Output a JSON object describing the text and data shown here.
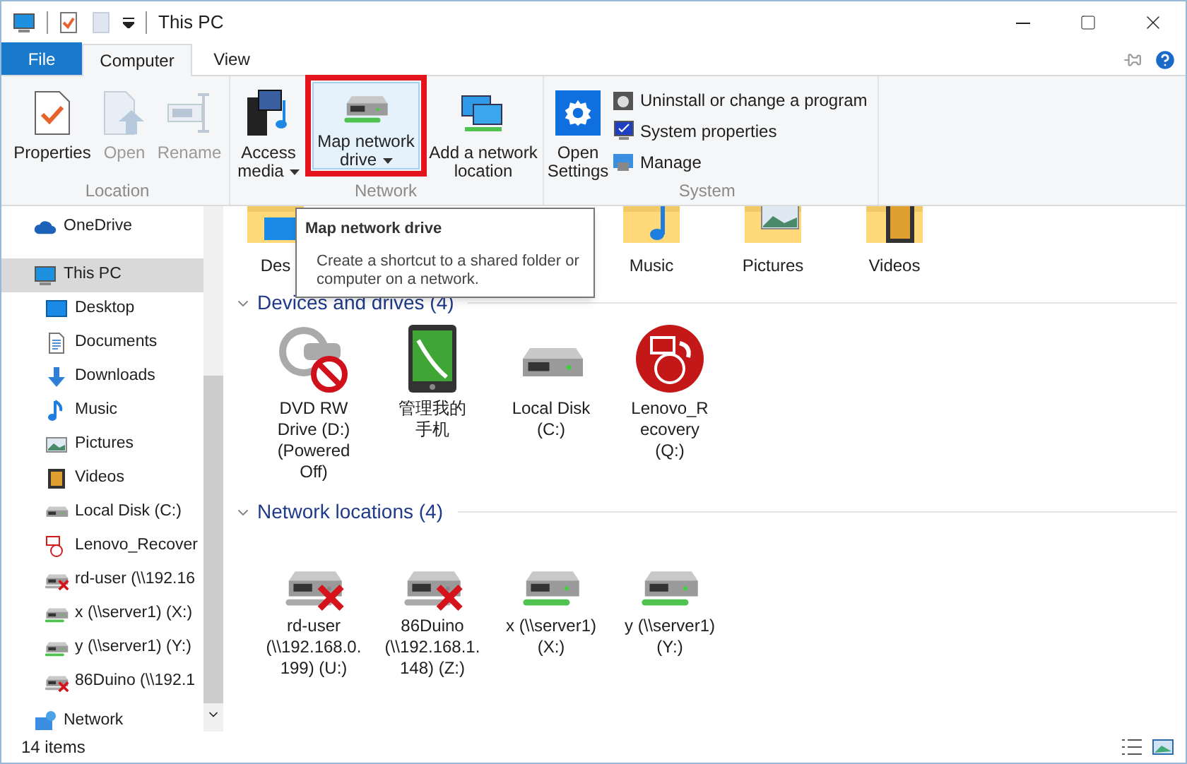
{
  "window": {
    "title": "This PC"
  },
  "ribbon_tabs": [
    {
      "label": "File",
      "kind": "file",
      "selected": false
    },
    {
      "label": "Computer",
      "kind": "tab",
      "selected": true
    },
    {
      "label": "View",
      "kind": "tab",
      "selected": false
    }
  ],
  "ribbon_groups": [
    {
      "label": "Location",
      "buttons": [
        {
          "label": "Properties",
          "kind": "properties",
          "disabled": false,
          "dropdown": false,
          "highlighted": false
        },
        {
          "label": "Open",
          "kind": "open",
          "disabled": true,
          "dropdown": false,
          "highlighted": false
        },
        {
          "label": "Rename",
          "kind": "rename",
          "disabled": true,
          "dropdown": false,
          "highlighted": false
        }
      ]
    },
    {
      "label": "Network",
      "buttons": [
        {
          "label": "Access media",
          "kind": "media",
          "disabled": false,
          "dropdown": true,
          "highlighted": false
        },
        {
          "label": "Map network drive",
          "kind": "map-drive",
          "disabled": false,
          "dropdown": true,
          "highlighted": true
        },
        {
          "label": "Add a network location",
          "kind": "add-location",
          "disabled": false,
          "dropdown": false,
          "highlighted": false
        }
      ]
    },
    {
      "label": "System",
      "buttons": [
        {
          "label": "Open Settings",
          "kind": "settings",
          "disabled": false,
          "dropdown": false,
          "highlighted": false
        }
      ],
      "small_buttons": [
        {
          "label": "Uninstall or change a program",
          "kind": "uninstall"
        },
        {
          "label": "System properties",
          "kind": "system-properties"
        },
        {
          "label": "Manage",
          "kind": "manage"
        }
      ]
    }
  ],
  "nav_pane": {
    "items": [
      {
        "label": "OneDrive",
        "kind": "onedrive",
        "selected": false
      },
      {
        "label": "This PC",
        "kind": "pc",
        "selected": true,
        "children": [
          {
            "label": "Desktop",
            "kind": "desktop",
            "selected": false
          },
          {
            "label": "Documents",
            "kind": "documents",
            "selected": false
          },
          {
            "label": "Downloads",
            "kind": "downloads",
            "selected": false
          },
          {
            "label": "Music",
            "kind": "music",
            "selected": false
          },
          {
            "label": "Pictures",
            "kind": "pictures",
            "selected": false
          },
          {
            "label": "Videos",
            "kind": "videos",
            "selected": false
          },
          {
            "label": "Local Disk (C:)",
            "kind": "disk",
            "selected": false
          },
          {
            "label": "Lenovo_Recover",
            "kind": "recovery",
            "selected": false
          },
          {
            "label": "rd-user (\\\\192.16",
            "kind": "net-drive",
            "connected": false,
            "selected": false
          },
          {
            "label": "x (\\\\server1) (X:)",
            "kind": "net-drive",
            "connected": true,
            "selected": false
          },
          {
            "label": "y (\\\\server1) (Y:)",
            "kind": "net-drive",
            "connected": true,
            "selected": false
          },
          {
            "label": "86Duino (\\\\192.1",
            "kind": "net-drive",
            "connected": false,
            "selected": false
          }
        ]
      },
      {
        "label": "Network",
        "kind": "network",
        "selected": false
      }
    ]
  },
  "folders": [
    {
      "label": "Des",
      "kind": "desktop"
    },
    {
      "label": "Music",
      "kind": "music"
    },
    {
      "label": "Pictures",
      "kind": "pictures"
    },
    {
      "label": "Videos",
      "kind": "videos"
    }
  ],
  "sections": [
    {
      "title": "Devices and drives (4)",
      "expanded": true,
      "items": [
        {
          "label": "DVD RW Drive (D:)(Powered Off)",
          "kind": "dvd"
        },
        {
          "label": "管理我的手机",
          "kind": "phone"
        },
        {
          "label": "Local Disk (C:)",
          "kind": "disk"
        },
        {
          "label": "Lenovo_Recovery (Q:)",
          "kind": "recovery"
        }
      ]
    },
    {
      "title": "Network locations (4)",
      "expanded": true,
      "items": [
        {
          "label": "rd-user (\\\\192.168.0.199) (U:)",
          "kind": "net-drive",
          "connected": false
        },
        {
          "label": "86Duino (\\\\192.168.1.148) (Z:)",
          "kind": "net-drive",
          "connected": false
        },
        {
          "label": "x (\\\\server1) (X:)",
          "kind": "net-drive",
          "connected": true
        },
        {
          "label": "y (\\\\server1) (Y:)",
          "kind": "net-drive",
          "connected": true
        }
      ]
    }
  ],
  "tooltip": {
    "title": "Map network drive",
    "text": "Create a shortcut to a shared folder or computer on a network."
  },
  "status_bar": {
    "count": "14 items",
    "views": [
      {
        "kind": "details"
      },
      {
        "kind": "large-icons"
      }
    ]
  }
}
